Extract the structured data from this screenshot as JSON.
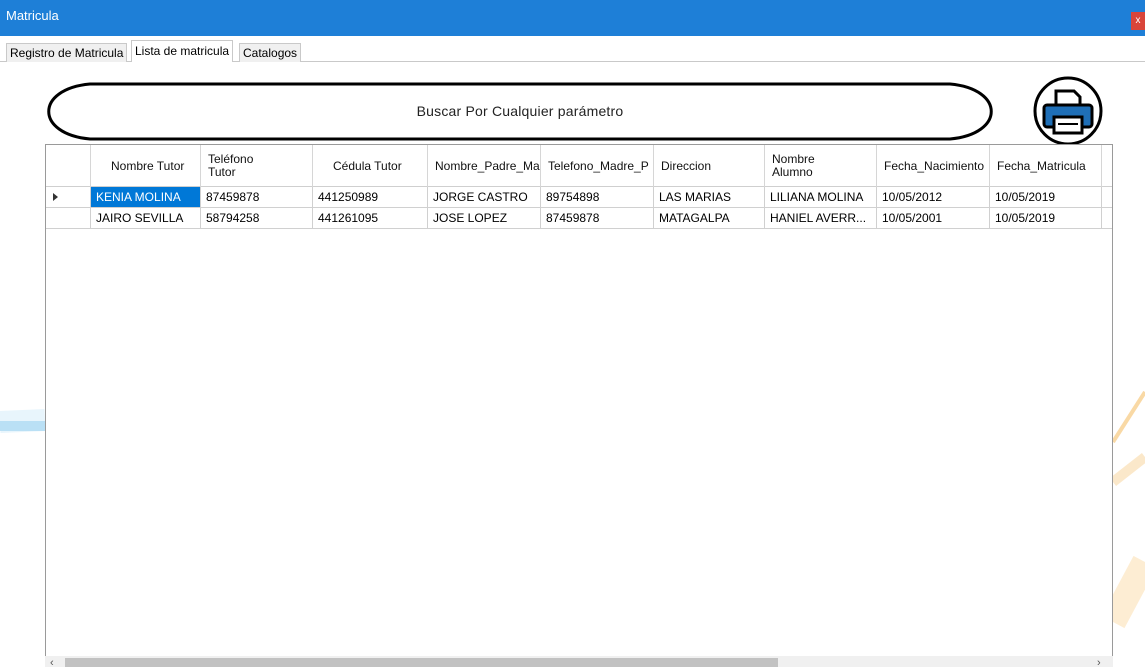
{
  "window": {
    "title": "Matricula",
    "close_label": "x"
  },
  "tabs": [
    {
      "label": "Registro de Matricula"
    },
    {
      "label": "Lista de matricula"
    },
    {
      "label": "Catalogos"
    }
  ],
  "search": {
    "label": "Buscar Por Cualquier parámetro"
  },
  "print": {
    "icon": "printer-icon"
  },
  "table": {
    "headers": [
      "Nombre Tutor",
      "Teléfono\nTutor",
      "Cédula Tutor",
      "Nombre_Padre_Ma",
      "Telefono_Madre_P",
      "Direccion",
      "Nombre\nAlumno",
      "Fecha_Nacimiento",
      "Fecha_Matricula"
    ],
    "rows": [
      [
        "KENIA  MOLINA",
        "87459878",
        "441250989",
        "JORGE CASTRO",
        "89754898",
        "LAS MARIAS",
        "LILIANA  MOLINA",
        "10/05/2012",
        "10/05/2019"
      ],
      [
        "JAIRO  SEVILLA",
        "58794258",
        "441261095",
        "JOSE LOPEZ",
        "87459878",
        "MATAGALPA",
        "HANIEL  AVERR...",
        "10/05/2001",
        "10/05/2019"
      ]
    ],
    "selected_row": 0,
    "selected_col": 0
  },
  "colors": {
    "titlebar": "#1e7fd7",
    "selection": "#0078d7",
    "close": "#d9453a"
  }
}
